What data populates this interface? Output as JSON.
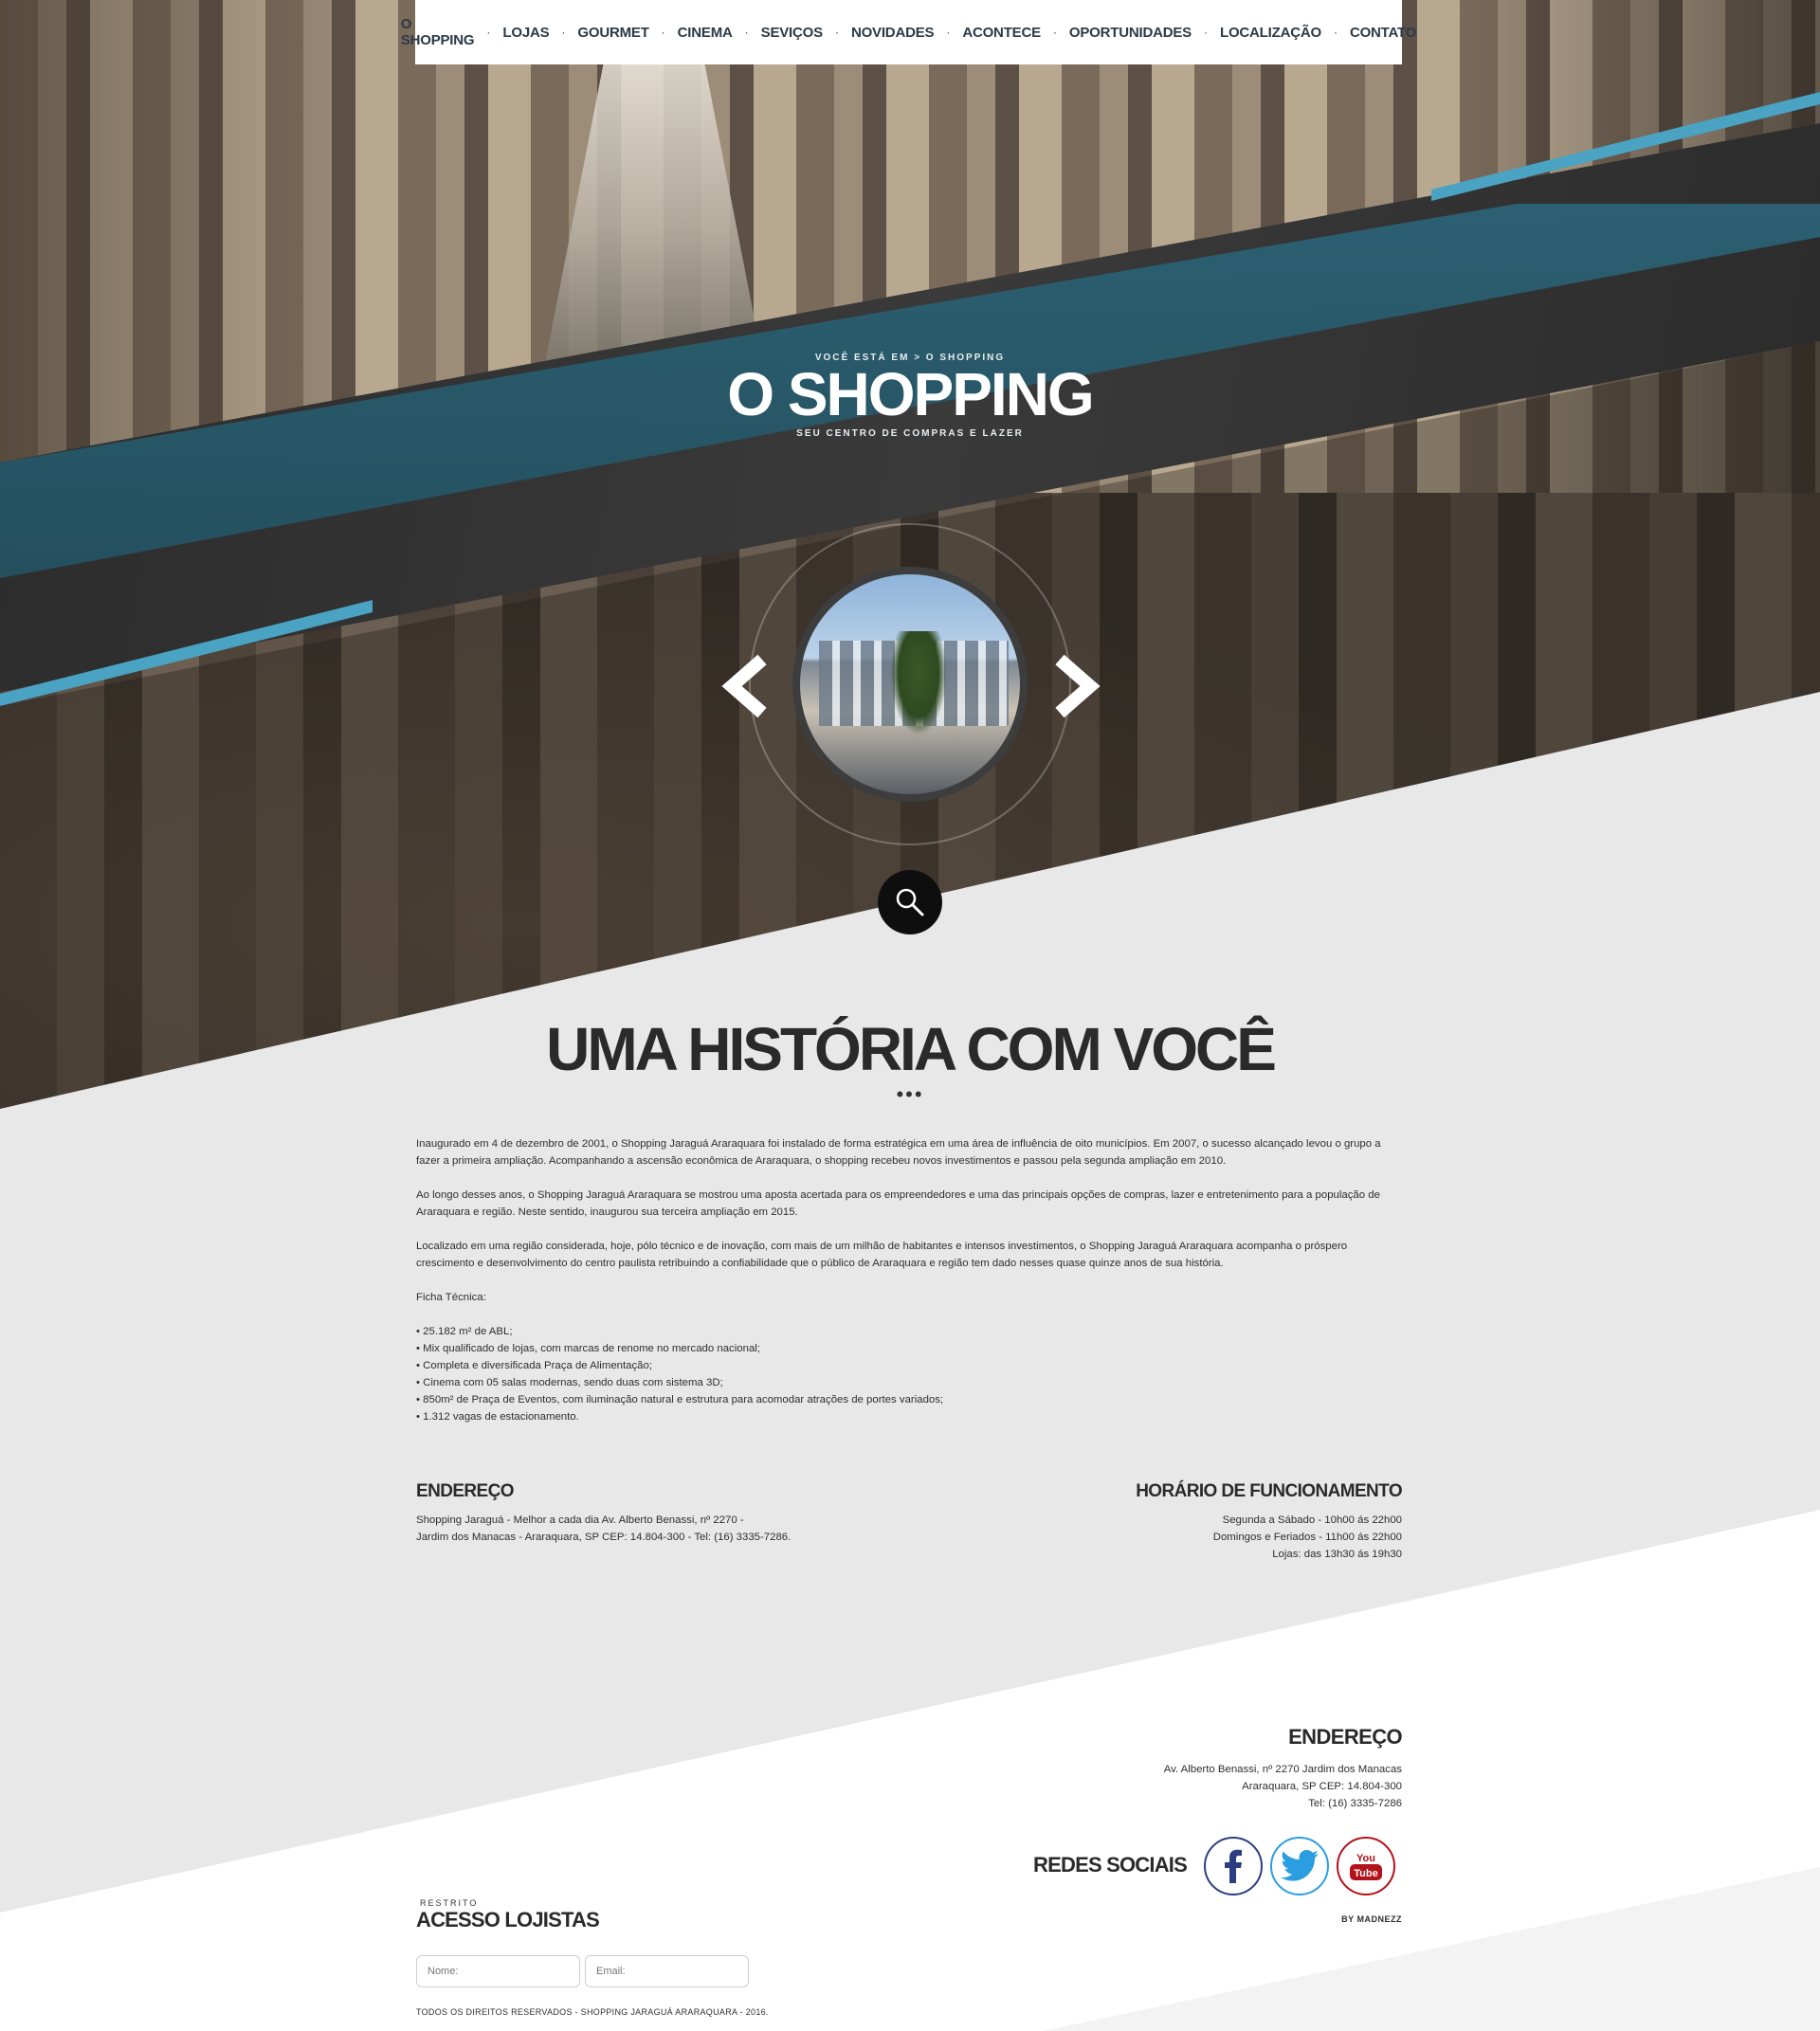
{
  "nav": {
    "items": [
      {
        "label": "O SHOPPING"
      },
      {
        "label": "LOJAS"
      },
      {
        "label": "GOURMET"
      },
      {
        "label": "CINEMA"
      },
      {
        "label": "SEVIÇOS"
      },
      {
        "label": "NOVIDADES"
      },
      {
        "label": "ACONTECE"
      },
      {
        "label": "OPORTUNIDADES"
      },
      {
        "label": "LOCALIZAÇÃO"
      },
      {
        "label": "CONTATO"
      }
    ],
    "separator": "·"
  },
  "hero": {
    "breadcrumb": "VOCÊ ESTÁ EM > O SHOPPING",
    "title": "O SHOPPING",
    "subtitle": "SEU CENTRO DE COMPRAS E LAZER",
    "accent_color": "#2f6b80",
    "stripe_color": "#4aa3c2"
  },
  "carousel": {
    "prev_icon": "chevron-left-icon",
    "next_icon": "chevron-right-icon",
    "search_icon": "search-icon"
  },
  "history": {
    "title": "UMA HISTÓRIA COM VOCÊ",
    "dots": "•••",
    "paragraphs": [
      "Inaugurado em 4 de dezembro de 2001, o Shopping Jaraguá Araraquara foi instalado de forma estratégica em uma área de influência de oito municípios. Em 2007, o sucesso alcançado levou o grupo a fazer a primeira ampliação. Acompanhando a ascensão econômica de Araraquara, o shopping recebeu novos investimentos e passou pela segunda ampliação em 2010.",
      "Ao longo desses anos, o Shopping Jaraguá Araraquara se mostrou uma aposta acertada para os empreendedores e uma das principais opções de compras, lazer e entretenimento para a população de Araraquara e região. Neste sentido, inaugurou sua terceira ampliação em 2015.",
      "Localizado em uma região considerada, hoje, pólo técnico e de inovação, com mais de um milhão de habitantes e intensos investimentos, o Shopping Jaraguá Araraquara acompanha o próspero crescimento e desenvolvimento do centro paulista retribuindo a confiabilidade que o público de Araraquara e região tem dado nesses quase quinze anos de sua história."
    ],
    "ficha_label": "Ficha Técnica:",
    "ficha_items": [
      "• 25.182 m² de ABL;",
      "• Mix qualificado de lojas, com marcas de renome no mercado nacional;",
      "• Completa e diversificada Praça de Alimentação;",
      "• Cinema com 05 salas modernas, sendo duas com sistema 3D;",
      "• 850m² de Praça de Eventos, com iluminação natural e estrutura para acomodar atrações de portes variados;",
      "• 1.312 vagas de estacionamento."
    ]
  },
  "endereco": {
    "heading": "ENDEREÇO",
    "lines": [
      "Shopping Jaraguá - Melhor a cada dia Av. Alberto Benassi, nº 2270 -",
      "Jardim dos Manacas - Araraquara, SP CEP: 14.804-300 - Tel: (16) 3335-7286."
    ]
  },
  "horario": {
    "heading": "HORÁRIO DE FUNCIONAMENTO",
    "lines": [
      "Segunda a Sábado - 10h00 ás 22h00",
      "Domingos e Feriados - 11h00 ás 22h00",
      "Lojas: das 13h30 ás 19h30"
    ]
  },
  "footer": {
    "address_heading": "ENDEREÇO",
    "address_lines": [
      "Av. Alberto Benassi, nº 2270 Jardim dos Manacas",
      "Araraquara, SP CEP: 14.804-300",
      "Tel: (16) 3335-7286"
    ],
    "social_label": "REDES SOCIAIS",
    "social": [
      {
        "name": "facebook-icon",
        "color": "#2c3d82"
      },
      {
        "name": "twitter-icon",
        "color": "#2a9ee0"
      },
      {
        "name": "youtube-icon",
        "color": "#b3121a",
        "text_top": "You",
        "text_bottom": "Tube"
      }
    ],
    "credit": "BY MADNEZZ",
    "restrito": "RESTRITO",
    "acesso_title": "ACESSO LOJISTAS",
    "name_placeholder": "Nome:",
    "email_placeholder": "Email:",
    "copyright": "TODOS OS DIREITOS RESERVADOS - SHOPPING JARAGUÁ ARARAQUARA - 2016."
  }
}
